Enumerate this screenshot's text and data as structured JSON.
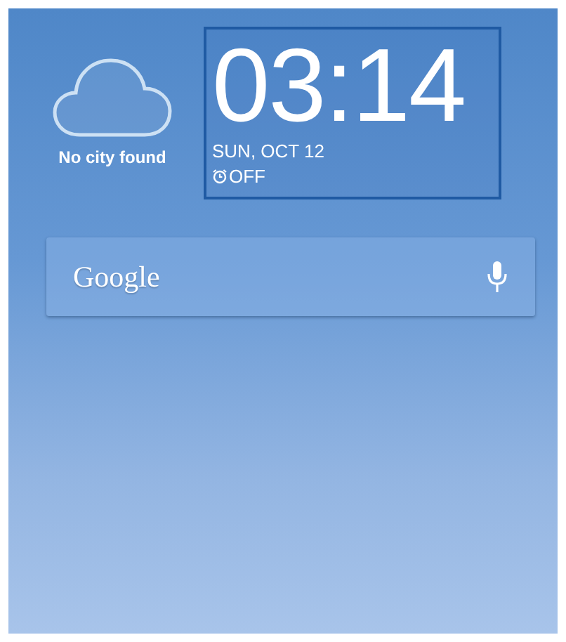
{
  "weather": {
    "city": "No city found"
  },
  "clock": {
    "time": "03:14",
    "date": "SUN, OCT 12",
    "alarm": "OFF",
    "selected": true
  },
  "search": {
    "logo": "Google"
  }
}
